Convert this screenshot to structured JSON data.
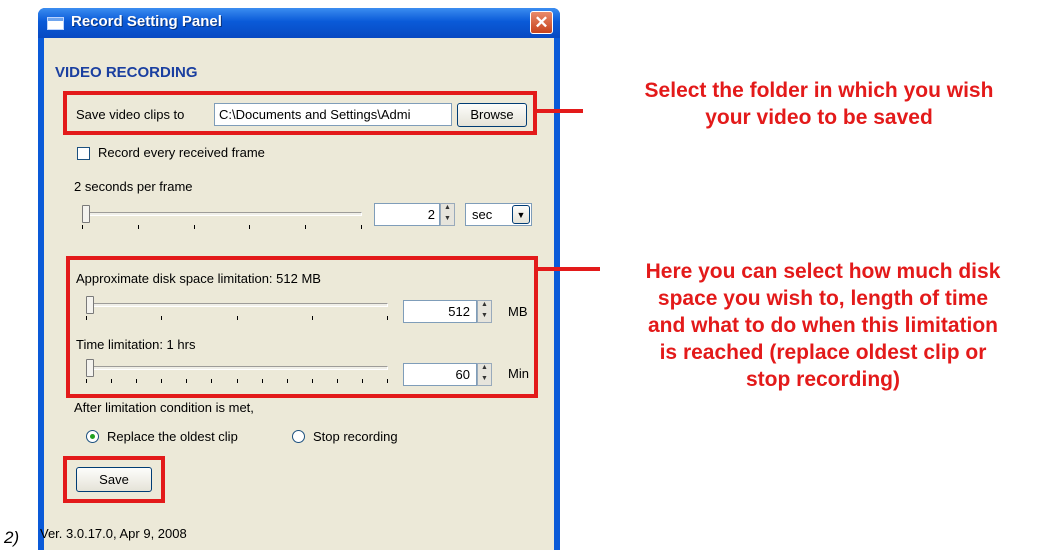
{
  "step_label": "2)",
  "window": {
    "title": "Record Setting Panel",
    "close_glyph": "✕"
  },
  "section_heading": "VIDEO RECORDING",
  "save_path": {
    "label": "Save video clips to",
    "value": "C:\\Documents and Settings\\Admi",
    "browse": "Browse"
  },
  "record_every_frame": {
    "label": "Record every received frame",
    "checked": false
  },
  "frame_rate": {
    "label": "2 seconds per frame",
    "value": "2",
    "unit": "sec",
    "unit_arrow": "▼",
    "slider_level": 0
  },
  "disk_space": {
    "label": "Approximate disk space limitation: 512 MB",
    "value": "512",
    "unit": "MB",
    "slider_level": 0
  },
  "time_limit": {
    "label": "Time limitation: 1 hrs",
    "value": "60",
    "unit": "Min",
    "slider_level": 0
  },
  "after_limit": {
    "label": "After limitation condition is met,",
    "options": [
      {
        "label": "Replace the oldest clip",
        "selected": true
      },
      {
        "label": "Stop recording",
        "selected": false
      }
    ]
  },
  "save_button": "Save",
  "version": "Ver. 3.0.17.0, Apr 9, 2008",
  "annotations": {
    "folder": [
      "Select the folder in which you wish",
      "your video to be saved"
    ],
    "limits": [
      "Here you can select how much disk",
      "space you wish to, length of time",
      "and what to do when this limitation",
      "is reached (replace oldest clip or",
      "stop recording)"
    ]
  },
  "colors": {
    "annotation_red": "#e31a1a",
    "title_blue": "#0a5ad8",
    "dialog_face": "#ece9d8"
  }
}
